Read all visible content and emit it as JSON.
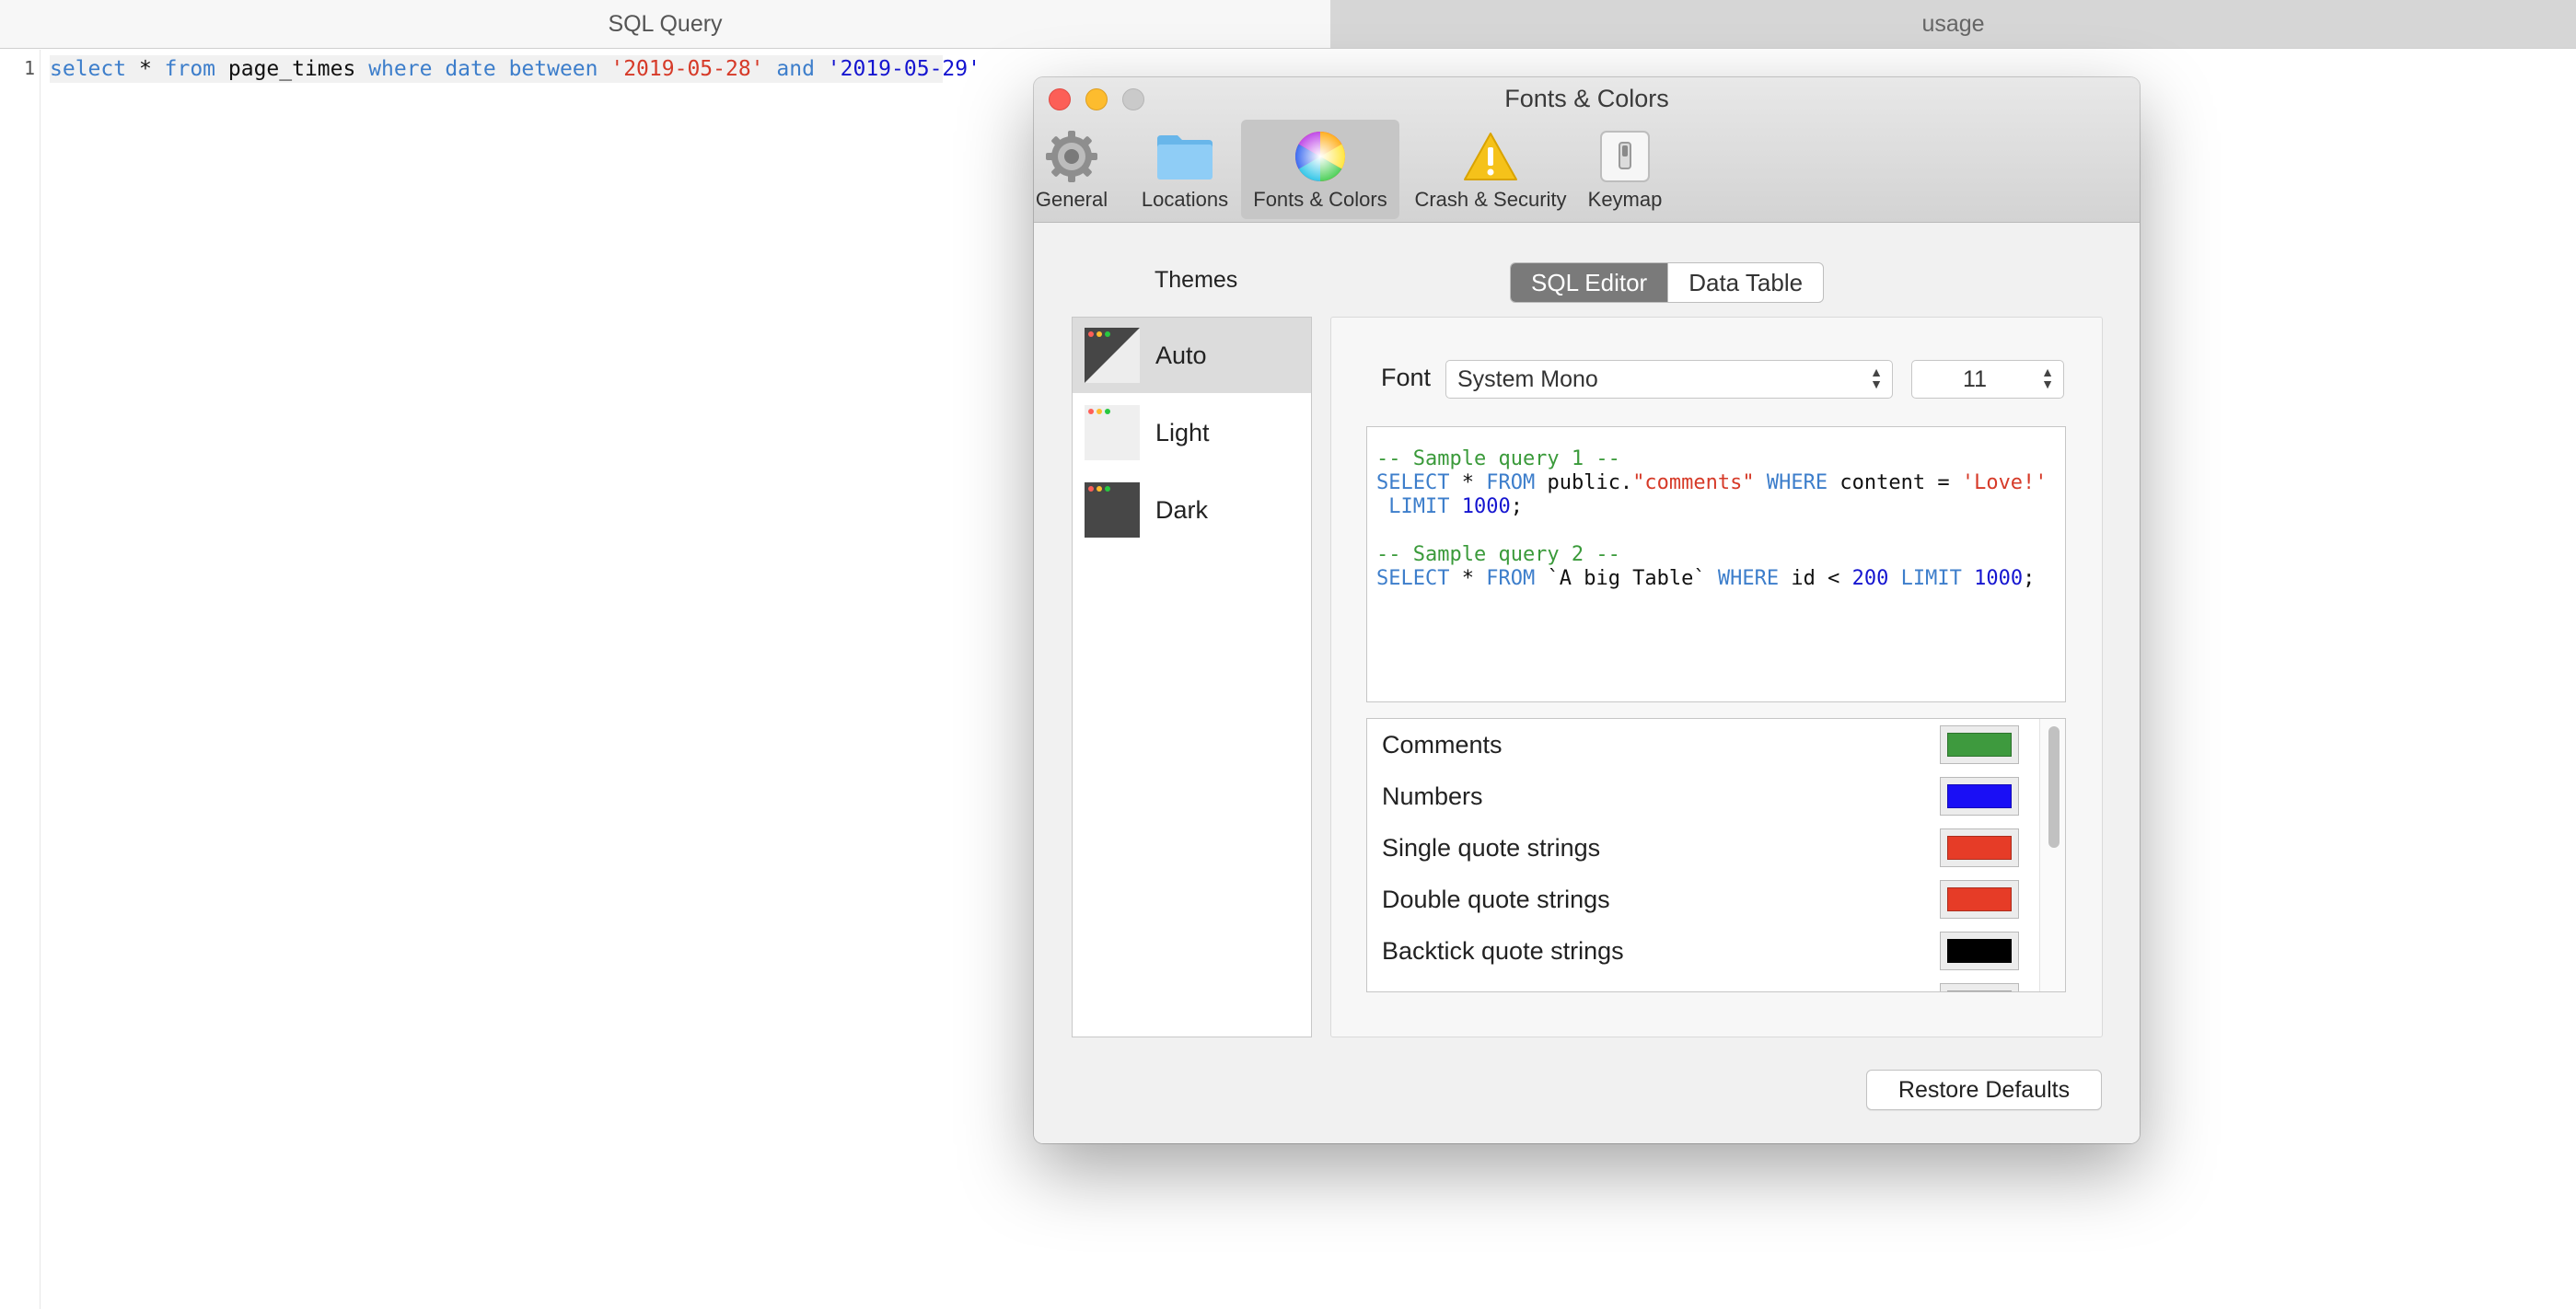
{
  "tabs": [
    {
      "label": "SQL Query",
      "active": true
    },
    {
      "label": "usage",
      "active": false
    }
  ],
  "editor": {
    "line_number": "1",
    "tokens": [
      {
        "t": "select",
        "k": "kw"
      },
      {
        "t": " * ",
        "k": "plain"
      },
      {
        "t": "from",
        "k": "kw"
      },
      {
        "t": " page_times ",
        "k": "plain"
      },
      {
        "t": "where",
        "k": "kw"
      },
      {
        "t": " ",
        "k": "plain"
      },
      {
        "t": "date",
        "k": "kw"
      },
      {
        "t": " ",
        "k": "plain"
      },
      {
        "t": "between",
        "k": "kw"
      },
      {
        "t": " ",
        "k": "plain"
      },
      {
        "t": "'2019-05-28'",
        "k": "str"
      },
      {
        "t": " ",
        "k": "plain"
      },
      {
        "t": "and",
        "k": "kw"
      },
      {
        "t": " ",
        "k": "plain"
      },
      {
        "t": "'2019-05-29'",
        "k": "num"
      }
    ]
  },
  "dialog": {
    "title": "Fonts & Colors",
    "toolbar": [
      {
        "label": "General",
        "icon": "gear-icon"
      },
      {
        "label": "Locations",
        "icon": "folder-icon"
      },
      {
        "label": "Fonts & Colors",
        "icon": "color-wheel-icon",
        "selected": true
      },
      {
        "label": "Crash & Security",
        "icon": "warning-icon"
      },
      {
        "label": "Keymap",
        "icon": "keymap-switch-icon"
      }
    ],
    "themes_title": "Themes",
    "themes": [
      {
        "name": "Auto",
        "selected": true
      },
      {
        "name": "Light"
      },
      {
        "name": "Dark"
      }
    ],
    "segments": {
      "sql_editor": "SQL Editor",
      "data_table": "Data Table",
      "selected": "SQL Editor"
    },
    "font_label": "Font",
    "font_value": "System Mono",
    "size_value": "11",
    "preview_lines": [
      [
        {
          "t": "-- Sample query 1 --",
          "k": "cmt"
        }
      ],
      [
        {
          "t": "SELECT",
          "k": "kw"
        },
        {
          "t": " * ",
          "k": "plain"
        },
        {
          "t": "FROM",
          "k": "kw"
        },
        {
          "t": " public.",
          "k": "plain"
        },
        {
          "t": "\"comments\"",
          "k": "str"
        },
        {
          "t": " ",
          "k": "plain"
        },
        {
          "t": "WHERE",
          "k": "kw"
        },
        {
          "t": " content = ",
          "k": "plain"
        },
        {
          "t": "'Love!'",
          "k": "str"
        }
      ],
      [
        {
          "t": " ",
          "k": "plain"
        },
        {
          "t": "LIMIT",
          "k": "kw"
        },
        {
          "t": " ",
          "k": "plain"
        },
        {
          "t": "1000",
          "k": "num"
        },
        {
          "t": ";",
          "k": "plain"
        }
      ],
      [
        {
          "t": " ",
          "k": "plain"
        }
      ],
      [
        {
          "t": "-- Sample query 2 --",
          "k": "cmt"
        }
      ],
      [
        {
          "t": "SELECT",
          "k": "kw"
        },
        {
          "t": " * ",
          "k": "plain"
        },
        {
          "t": "FROM",
          "k": "kw"
        },
        {
          "t": " `A big Table` ",
          "k": "plain"
        },
        {
          "t": "WHERE",
          "k": "kw"
        },
        {
          "t": " id < ",
          "k": "plain"
        },
        {
          "t": "200",
          "k": "num"
        },
        {
          "t": " ",
          "k": "plain"
        },
        {
          "t": "LIMIT",
          "k": "kw"
        },
        {
          "t": " ",
          "k": "plain"
        },
        {
          "t": "1000",
          "k": "num"
        },
        {
          "t": ";",
          "k": "plain"
        }
      ]
    ],
    "color_items": [
      {
        "name": "Comments",
        "color": "#3e9a3e"
      },
      {
        "name": "Numbers",
        "color": "#1a0ff5"
      },
      {
        "name": "Single quote strings",
        "color": "#e63c27"
      },
      {
        "name": "Double quote strings",
        "color": "#e63c27"
      },
      {
        "name": "Backtick quote strings",
        "color": "#000000"
      },
      {
        "name": "",
        "color": "#d8d8d8"
      }
    ],
    "restore_label": "Restore Defaults"
  },
  "colors": {
    "keyword": "#3d7ecb",
    "string": "#d63a28",
    "number": "#1515d0",
    "comment": "#3a9a3a",
    "plain": "#111111"
  }
}
